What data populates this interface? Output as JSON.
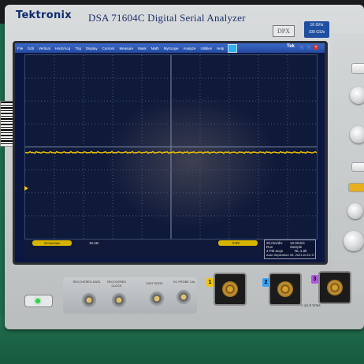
{
  "device": {
    "brand": "Tektronix",
    "model_title": "DSA 71604C Digital Serial Analyzer",
    "dpx_label": "DPX",
    "spec_badge_line1": "16 GHz",
    "spec_badge_line2": "100 GS/s"
  },
  "menubar": {
    "items": [
      "File",
      "Edit",
      "Vertical",
      "Horiz/Acq",
      "Trig",
      "Display",
      "Cursors",
      "Measure",
      "Mask",
      "Math",
      "MyScope",
      "Analyze",
      "Utilities",
      "Help"
    ],
    "right_label": "Tek"
  },
  "status": {
    "ch1_label": "20.0mV/div",
    "ch1_offset": "10.4Ω",
    "trig_level": "0.0V",
    "acq_rate": "10.0GS/s",
    "acq_points": "20.0ns/div",
    "acq_mode": "Run",
    "acq_sample": "Sample",
    "acq_count": "2 FM acqs",
    "acq_rl": "RL:1.0k",
    "acq_date": "Auto September 06, 2021",
    "acq_time": "10:21:17"
  },
  "front_panel": {
    "inputs": [
      {
        "label": "RECOVERED DATA"
      },
      {
        "label": "RECOVERED CLOCK"
      },
      {
        "label": "FAST EDGE"
      },
      {
        "label": "DC PROBE CAL"
      }
    ],
    "channels": [
      "1",
      "2",
      "3"
    ],
    "warning_text": "≤1.5 Vrms"
  },
  "colors": {
    "ch1": "#f2c500",
    "ch2": "#2fa3ff",
    "ch3": "#b054e6",
    "menubar": "#2c56b4",
    "screen_bg": "#0b1740"
  },
  "trace": {
    "channel": "ch1",
    "level_fraction": 0.53
  }
}
